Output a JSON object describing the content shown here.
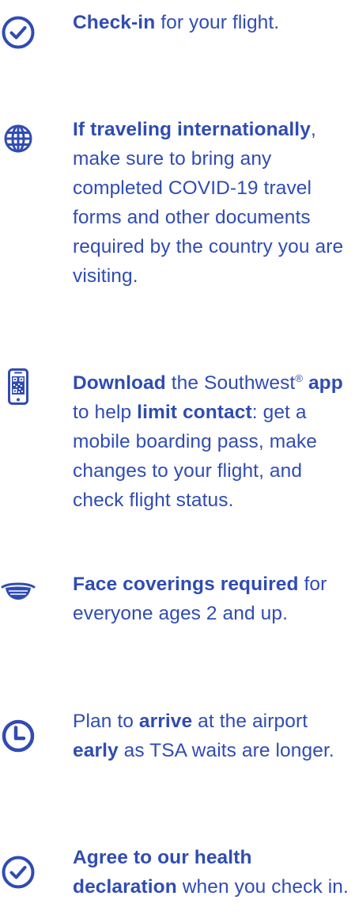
{
  "colors": {
    "text": "#304CB2",
    "icon": "#304CB2"
  },
  "items": [
    {
      "icon": "check-circle-icon",
      "parts": [
        {
          "b": "Check-in"
        },
        {
          "t": " for your flight."
        }
      ]
    },
    {
      "icon": "globe-icon",
      "parts": [
        {
          "b": "If traveling internationally"
        },
        {
          "t": ", make sure to bring any completed COVID-19 travel forms and other documents required by the country you are visiting."
        }
      ]
    },
    {
      "icon": "mobile-qr-icon",
      "parts": [
        {
          "b": "Download"
        },
        {
          "t": " the Southwest"
        },
        {
          "sup": "®"
        },
        {
          "t": " "
        },
        {
          "b": "app"
        },
        {
          "t": " to help "
        },
        {
          "b": "limit contact"
        },
        {
          "t": ": get a mobile boarding pass, make changes to your flight, and check flight status."
        }
      ]
    },
    {
      "icon": "face-mask-icon",
      "parts": [
        {
          "b": "Face coverings required"
        },
        {
          "t": " for everyone ages 2 and up."
        }
      ]
    },
    {
      "icon": "clock-icon",
      "parts": [
        {
          "t": "Plan to "
        },
        {
          "b": "arrive"
        },
        {
          "t": " at the airport "
        },
        {
          "b": "early"
        },
        {
          "t": " as TSA waits are longer."
        }
      ]
    },
    {
      "icon": "check-circle-icon",
      "parts": [
        {
          "b": "Agree to our health declaration"
        },
        {
          "t": " when you check in."
        }
      ]
    }
  ]
}
